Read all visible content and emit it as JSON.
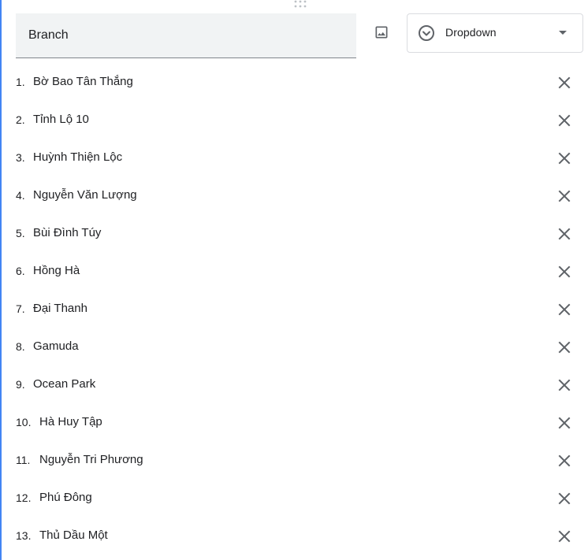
{
  "question": {
    "title_value": "Branch",
    "type_label": "Dropdown"
  },
  "icons": {
    "drag": "drag-handle-icon",
    "image": "image-icon",
    "type": "dropdown-circle-icon",
    "caret": "caret-down-icon",
    "remove": "close-icon"
  },
  "colors": {
    "accent": "#4285f4",
    "icon": "#5f6368",
    "input_bg": "#f1f3f4"
  },
  "options": [
    {
      "num": "1.",
      "label": "Bờ Bao Tân Thắng"
    },
    {
      "num": "2.",
      "label": "Tỉnh Lộ 10"
    },
    {
      "num": "3.",
      "label": "Huỳnh Thiện Lộc"
    },
    {
      "num": "4.",
      "label": "Nguyễn Văn Lượng"
    },
    {
      "num": "5.",
      "label": "Bùi Đình Túy"
    },
    {
      "num": "6.",
      "label": "Hồng Hà"
    },
    {
      "num": "7.",
      "label": "Đại Thanh"
    },
    {
      "num": "8.",
      "label": "Gamuda"
    },
    {
      "num": "9.",
      "label": "Ocean Park"
    },
    {
      "num": "10.",
      "label": "Hà Huy Tập"
    },
    {
      "num": "11.",
      "label": "Nguyễn Tri Phương"
    },
    {
      "num": "12.",
      "label": "Phú Đông"
    },
    {
      "num": "13.",
      "label": "Thủ Dầu Một"
    }
  ]
}
